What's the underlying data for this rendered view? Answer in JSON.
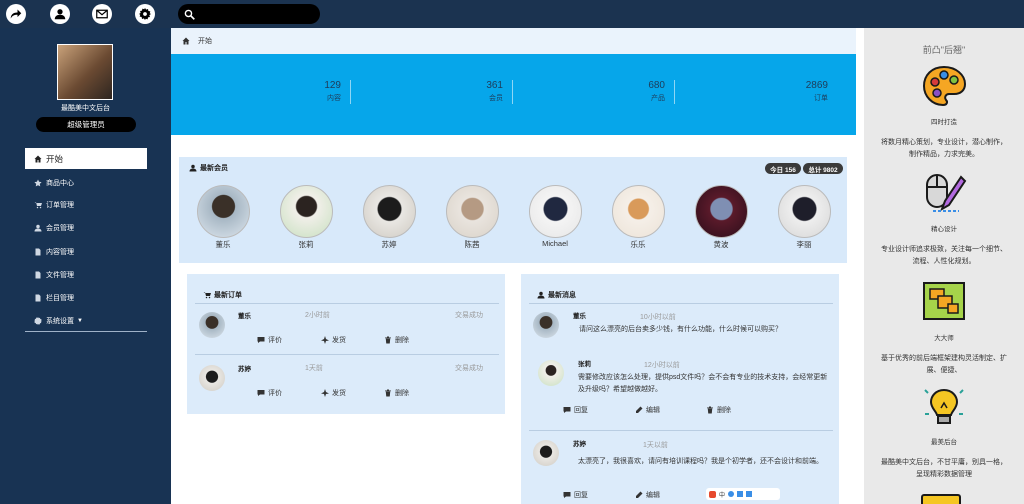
{
  "topbar": {
    "icons": [
      "share-icon",
      "user-icon",
      "mail-icon",
      "gear-icon",
      "search-icon"
    ],
    "search_placeholder": ""
  },
  "sidebar": {
    "site_title": "最酷美中文后台",
    "role": "超级管理员",
    "items": [
      {
        "label": "开始",
        "icon": "home-icon"
      },
      {
        "label": "商品中心",
        "icon": "star-icon"
      },
      {
        "label": "订单管理",
        "icon": "cart-icon"
      },
      {
        "label": "会员管理",
        "icon": "user-icon"
      },
      {
        "label": "内容管理",
        "icon": "document-icon"
      },
      {
        "label": "文件管理",
        "icon": "file-icon"
      },
      {
        "label": "栏目管理",
        "icon": "file-icon"
      },
      {
        "label": "系统设置",
        "icon": "gear-icon"
      }
    ]
  },
  "breadcrumb": {
    "label": "开始"
  },
  "stats": [
    {
      "value": "129",
      "label": "内容"
    },
    {
      "value": "361",
      "label": "会员"
    },
    {
      "value": "680",
      "label": "产品"
    },
    {
      "value": "2869",
      "label": "订单"
    }
  ],
  "members": {
    "title": "最新会员",
    "today": "今日 156",
    "total": "总计 9802",
    "list": [
      "董乐",
      "张莉",
      "苏婷",
      "陈茜",
      "Michael",
      "乐乐",
      "黄波",
      "李丽"
    ]
  },
  "orders": {
    "title": "最新订单",
    "items": [
      {
        "name": "董乐",
        "time": "2小时前",
        "status": "交易成功"
      },
      {
        "name": "苏婷",
        "time": "1天前",
        "status": "交易成功"
      }
    ],
    "actions": {
      "comment": "评价",
      "ship": "发货",
      "delete": "删除"
    }
  },
  "messages": {
    "title": "最新消息",
    "items": [
      {
        "name": "董乐",
        "time": "10小时以前",
        "text": "请问这么漂亮的后台卖多少钱，有什么功能，什么时候可以购买？"
      },
      {
        "name": "张莉",
        "time": "12小时以前",
        "text": "需要修改应该怎么处理，提供psd文件吗？会不会有专业的技术支持，会经常更新及升级吗？希望越做越好。"
      },
      {
        "name": "苏婷",
        "time": "1天以前",
        "text": "太漂亮了，我很喜欢，请问有培训课程吗？我是个初学者，还不会设计和前端。"
      }
    ],
    "actions": {
      "reply": "回复",
      "edit": "编辑",
      "delete": "删除"
    }
  },
  "right": {
    "title": "前凸\"后翘\"",
    "features": [
      {
        "title": "四时打造",
        "desc": "将数月精心策划，专业设计，潜心制作，制作精品，力求完美。",
        "icon": "palette-icon"
      },
      {
        "title": "精心设计",
        "desc": "专业设计师追求极致，关注每一个细节、流程、人性化规划。",
        "icon": "mouse-brush-icon"
      },
      {
        "title": "大大师",
        "desc": "基于优秀的前后端框架建构灵活制定、扩展、便捷、",
        "icon": "layout-icon"
      },
      {
        "title": "最美后台",
        "desc": "最酷美中文后台，不甘平庸，别具一格，呈现精彩数据管理",
        "icon": "lightbulb-icon"
      }
    ]
  },
  "colors": {
    "sidebar": "#183353",
    "topbar": "#1b3350",
    "accent": "#06a6ea",
    "panel": "#d8e9fa"
  }
}
